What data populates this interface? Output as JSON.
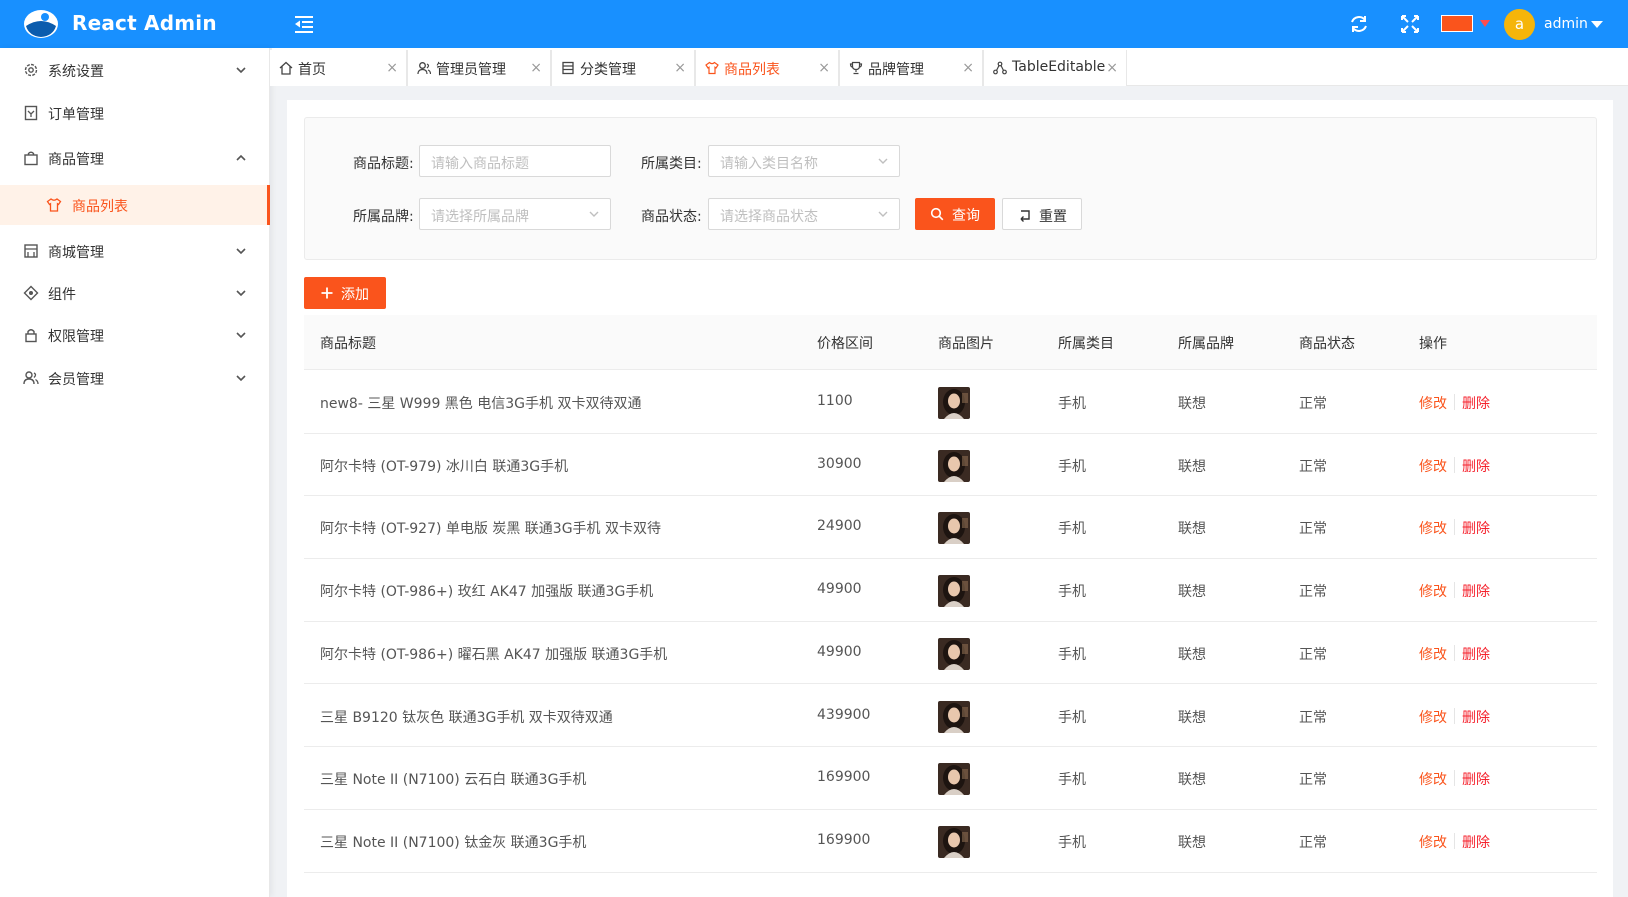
{
  "header": {
    "app_title": "React Admin",
    "theme_color": "#fa541c",
    "avatar_letter": "a",
    "username": "admin",
    "brand_color": "#1890ff"
  },
  "sidebar": {
    "items": [
      {
        "label": "系统设置",
        "icon": "gear-icon",
        "expanded": false
      },
      {
        "label": "订单管理",
        "icon": "order-icon"
      },
      {
        "label": "商品管理",
        "icon": "bag-icon",
        "expanded": true
      },
      {
        "label": "商品列表",
        "icon": "shirt-icon",
        "active": true
      },
      {
        "label": "商城管理",
        "icon": "shop-icon",
        "expanded": false
      },
      {
        "label": "组件",
        "icon": "component-icon",
        "expanded": false
      },
      {
        "label": "权限管理",
        "icon": "lock-icon",
        "expanded": false
      },
      {
        "label": "会员管理",
        "icon": "users-icon",
        "expanded": false
      }
    ]
  },
  "tabs": [
    {
      "label": "首页",
      "icon": "home-icon",
      "close": "×"
    },
    {
      "label": "管理员管理",
      "icon": "admin-icon",
      "close": "×"
    },
    {
      "label": "分类管理",
      "icon": "list-icon",
      "close": "×"
    },
    {
      "label": "商品列表",
      "icon": "shirt-icon",
      "close": "×",
      "active": true
    },
    {
      "label": "品牌管理",
      "icon": "trophy-icon",
      "close": "×"
    },
    {
      "label": "TableEditable",
      "icon": "cluster-icon",
      "close": "×"
    }
  ],
  "search": {
    "title_label": "商品标题:",
    "title_placeholder": "请输入商品标题",
    "category_label": "所属类目:",
    "category_placeholder": "请输入类目名称",
    "brand_label": "所属品牌:",
    "brand_placeholder": "请选择所属品牌",
    "status_label": "商品状态:",
    "status_placeholder": "请选择商品状态",
    "query_button": "查询",
    "reset_button": "重置"
  },
  "toolbar": {
    "add_button": "添加"
  },
  "table": {
    "columns": [
      "商品标题",
      "价格区间",
      "商品图片",
      "所属类目",
      "所属品牌",
      "商品状态",
      "操作"
    ],
    "edit_label": "修改",
    "delete_label": "删除",
    "rows": [
      {
        "title": "new8- 三星 W999 黑色 电信3G手机 双卡双待双通",
        "price": "1100",
        "category": "手机",
        "brand": "联想",
        "status": "正常"
      },
      {
        "title": "阿尔卡特 (OT-979) 冰川白 联通3G手机",
        "price": "30900",
        "category": "手机",
        "brand": "联想",
        "status": "正常"
      },
      {
        "title": "阿尔卡特 (OT-927) 单电版 炭黑 联通3G手机 双卡双待",
        "price": "24900",
        "category": "手机",
        "brand": "联想",
        "status": "正常"
      },
      {
        "title": "阿尔卡特 (OT-986+) 玫红 AK47 加强版 联通3G手机",
        "price": "49900",
        "category": "手机",
        "brand": "联想",
        "status": "正常"
      },
      {
        "title": "阿尔卡特 (OT-986+) 曜石黑 AK47 加强版 联通3G手机",
        "price": "49900",
        "category": "手机",
        "brand": "联想",
        "status": "正常"
      },
      {
        "title": "三星 B9120 钛灰色 联通3G手机 双卡双待双通",
        "price": "439900",
        "category": "手机",
        "brand": "联想",
        "status": "正常"
      },
      {
        "title": "三星 Note II (N7100) 云石白 联通3G手机",
        "price": "169900",
        "category": "手机",
        "brand": "联想",
        "status": "正常"
      },
      {
        "title": "三星 Note II (N7100) 钛金灰 联通3G手机",
        "price": "169900",
        "category": "手机",
        "brand": "联想",
        "status": "正常"
      }
    ]
  }
}
